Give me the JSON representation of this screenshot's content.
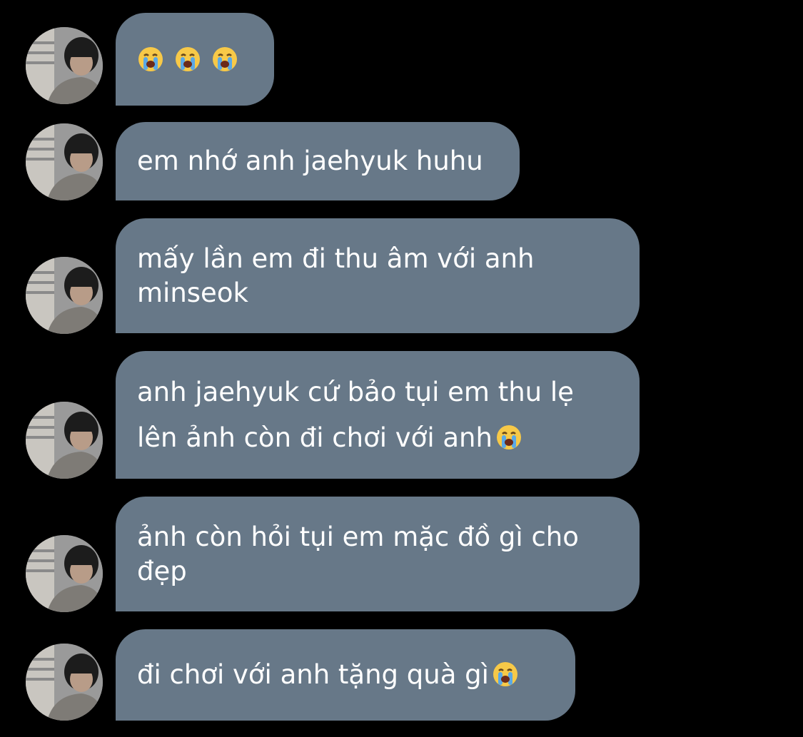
{
  "messages": [
    {
      "text": "",
      "emoji": [
        "loudly-crying-face",
        "loudly-crying-face",
        "loudly-crying-face"
      ]
    },
    {
      "text": "em nhớ anh jaehyuk huhu",
      "emoji": []
    },
    {
      "text": "mấy lần em đi thu âm với anh minseok",
      "emoji": []
    },
    {
      "text": "anh jaehyuk cứ bảo tụi em thu lẹ lên ảnh còn đi chơi với anh",
      "emoji": [
        "loudly-crying-face"
      ]
    },
    {
      "text": "ảnh còn hỏi tụi em mặc đồ gì cho đẹp",
      "emoji": []
    },
    {
      "text": "đi chơi với anh tặng quà gì",
      "emoji": [
        "loudly-crying-face"
      ]
    }
  ],
  "colors": {
    "background": "#000000",
    "bubble": "#677888",
    "text": "#ffffff"
  }
}
